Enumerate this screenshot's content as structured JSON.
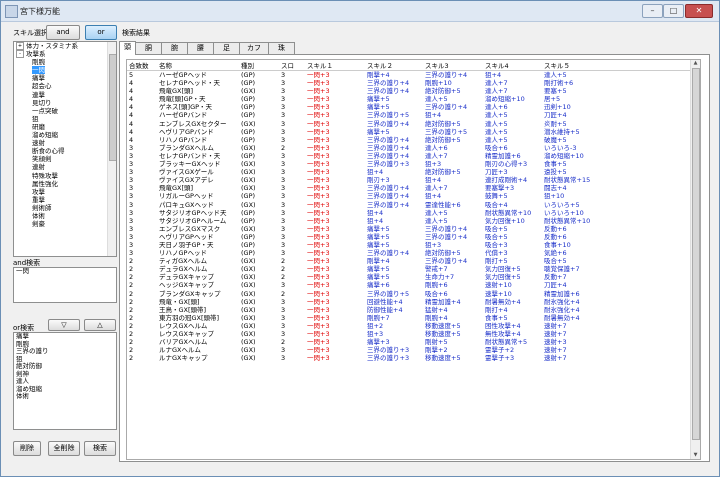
{
  "window": {
    "title": "宮下様万能",
    "min": "–",
    "max": "□",
    "close": "✕"
  },
  "left": {
    "skill_select_label": "スキル選択",
    "and_label": "and",
    "or_label": "or",
    "tree": [
      {
        "t": "体力・スタミナ系",
        "exp": "+",
        "lv": 0
      },
      {
        "t": "攻撃系",
        "exp": "-",
        "lv": 0
      },
      {
        "t": "剛腕",
        "lv": 1
      },
      {
        "t": "一閃",
        "lv": 1,
        "sel": true
      },
      {
        "t": "痛撃",
        "lv": 1
      },
      {
        "t": "超会心",
        "lv": 1
      },
      {
        "t": "連撃",
        "lv": 1
      },
      {
        "t": "見切り",
        "lv": 1
      },
      {
        "t": "一点突破",
        "lv": 1
      },
      {
        "t": "狙",
        "lv": 1
      },
      {
        "t": "研磨",
        "lv": 1
      },
      {
        "t": "溜め短縮",
        "lv": 1
      },
      {
        "t": "速射",
        "lv": 1
      },
      {
        "t": "断食の心得",
        "lv": 1
      },
      {
        "t": "笑顔剣",
        "lv": 1
      },
      {
        "t": "連射",
        "lv": 1
      },
      {
        "t": "特殊攻撃",
        "lv": 1
      },
      {
        "t": "属性強化",
        "lv": 1
      },
      {
        "t": "攻撃",
        "lv": 1
      },
      {
        "t": "重撃",
        "lv": 1
      },
      {
        "t": "剣術師",
        "lv": 1
      },
      {
        "t": "体術",
        "lv": 1
      },
      {
        "t": "剣豪",
        "lv": 1
      }
    ],
    "and_search_label": "and検索",
    "and_items": [
      "一閃"
    ],
    "down_btn": "▽",
    "up_btn": "△",
    "or_search_label": "or検索",
    "or_items": [
      "痛撃",
      "剛腕",
      "三界の護り",
      "狙",
      "絶対防御",
      "剣神",
      "達人",
      "溜め短縮",
      "体術"
    ],
    "delete_btn": "削除",
    "clear_all_btn": "全削除",
    "search_btn": "検索"
  },
  "results": {
    "label": "検索結果",
    "tabs": [
      "頭",
      "胴",
      "腕",
      "腰",
      "足",
      "カフ",
      "珠"
    ],
    "columns": [
      "合致数",
      "名称",
      "種別",
      "スロ",
      "スキル１",
      "スキル２",
      "スキル3",
      "スキル4",
      "スキル５"
    ],
    "rows": [
      [
        "5",
        "ハーゼGPヘッド",
        "(GP)",
        "3",
        "一閃+3",
        "剛撃+4",
        "三界の護り+4",
        "狙+4",
        "達人+5"
      ],
      [
        "4",
        "セレナGPヘッド・天",
        "(GP)",
        "3",
        "一閃+3",
        "三界の護り+4",
        "剛腕+10",
        "達人+7",
        "剛打術+6"
      ],
      [
        "4",
        "飛竜GX[頭]",
        "(GX)",
        "3",
        "一閃+3",
        "三界の護り+4",
        "絶対防御+5",
        "達人+7",
        "要塞+5"
      ],
      [
        "4",
        "飛竜[頭]GP・天",
        "(GP)",
        "3",
        "一閃+3",
        "痛撃+5",
        "達人+5",
        "溜め短縮+10",
        "居+5"
      ],
      [
        "4",
        "ゲネス[頭]GP・天",
        "(GP)",
        "3",
        "一閃+3",
        "痛撃+5",
        "三界の護り+4",
        "達人+6",
        "迅剣+10"
      ],
      [
        "4",
        "ハーゼGPバンド",
        "(GP)",
        "3",
        "一閃+3",
        "三界の護り+5",
        "狙+4",
        "達人+5",
        "刀匠+4"
      ],
      [
        "4",
        "エンブレスGXセクター",
        "(GX)",
        "3",
        "一閃+3",
        "三界の護り+4",
        "絶対防御+5",
        "達人+5",
        "炎耐+5"
      ],
      [
        "4",
        "ヘヴリアGPバンド",
        "(GP)",
        "3",
        "一閃+3",
        "痛撃+5",
        "三界の護り+5",
        "達人+5",
        "潜水維持+5"
      ],
      [
        "4",
        "リハノGPバンド",
        "(GP)",
        "3",
        "一閃+3",
        "三界の護り+4",
        "絶対防御+5",
        "達人+5",
        "破魔+5"
      ],
      [
        "3",
        "ブランダGXヘルム",
        "(GX)",
        "2",
        "一閃+3",
        "三界の護り+4",
        "達人+6",
        "吸合+6",
        "いろいろ-3"
      ],
      [
        "3",
        "セレナGPバンド・天",
        "(GP)",
        "3",
        "一閃+3",
        "三界の護り+4",
        "達人+7",
        "精霊加護+6",
        "溜め短縮+10"
      ],
      [
        "3",
        "ブラッキーGXヘッド",
        "(GX)",
        "3",
        "一閃+3",
        "三界の護り+3",
        "狙+3",
        "剛刃の心得+3",
        "食事+5"
      ],
      [
        "3",
        "ヴァイスGXゲール",
        "(GX)",
        "3",
        "一閃+3",
        "狙+4",
        "絶対防御+5",
        "刀匠+3",
        "遠投+5"
      ],
      [
        "3",
        "ヴァイスGXアデレ",
        "(GX)",
        "3",
        "一閃+3",
        "剛刃+3",
        "狙+4",
        "連打成剛術+4",
        "耐状態異常+15"
      ],
      [
        "3",
        "飛竜GX[頭]",
        "(GX)",
        "3",
        "一閃+3",
        "三界の護り+4",
        "達人+7",
        "要塞撃+3",
        "闘志+4"
      ],
      [
        "3",
        "リガルーGPヘッド",
        "(GP)",
        "3",
        "一閃+3",
        "三界の護り+4",
        "狙+4",
        "鼓舞+5",
        "狙+10"
      ],
      [
        "3",
        "パロキュGXヘッド",
        "(GX)",
        "3",
        "一閃+3",
        "三界の護り+4",
        "霊達性能+6",
        "吸合+4",
        "いろいろ+5"
      ],
      [
        "3",
        "サタジリオGPヘッド天",
        "(GP)",
        "3",
        "一閃+3",
        "狙+4",
        "達人+5",
        "耐状態異常+10",
        "いろいろ+10"
      ],
      [
        "3",
        "サタジリオGPヘルーム",
        "(GP)",
        "3",
        "一閃+3",
        "狙+4",
        "達人+5",
        "気力回復+10",
        "耐状態異常+10"
      ],
      [
        "3",
        "エンブレスGXマスク",
        "(GX)",
        "3",
        "一閃+3",
        "痛撃+5",
        "三界の護り+4",
        "吸合+5",
        "反動+6"
      ],
      [
        "3",
        "ヘヴリアGPヘッド",
        "(GP)",
        "3",
        "一閃+3",
        "痛撃+5",
        "三界の護り+4",
        "吸合+5",
        "反動+6"
      ],
      [
        "3",
        "天日ノ羽子GP・天",
        "(GP)",
        "3",
        "一閃+3",
        "痛撃+5",
        "狙+3",
        "吸合+3",
        "食事+10"
      ],
      [
        "3",
        "リハノGPヘッド",
        "(GP)",
        "3",
        "一閃+3",
        "三界の護り+4",
        "絶対防御+5",
        "代償+3",
        "気絶+6"
      ],
      [
        "2",
        "ティガGXヘルム",
        "(GX)",
        "2",
        "一閃+3",
        "剛撃+4",
        "三界の護り+4",
        "剛打+5",
        "吸合+5"
      ],
      [
        "2",
        "デュラGXヘルム",
        "(GX)",
        "2",
        "一閃+3",
        "痛撃+5",
        "警戒+7",
        "気力回復+5",
        "聴覚保護+7"
      ],
      [
        "2",
        "デュラGXキャップ",
        "(GX)",
        "2",
        "一閃+3",
        "痛撃+5",
        "生命力+7",
        "気力回復+5",
        "反動+7"
      ],
      [
        "2",
        "ヘッジGXキャップ",
        "(GX)",
        "3",
        "一閃+3",
        "痛撃+6",
        "剛腕+6",
        "速射+10",
        "刀匠+4"
      ],
      [
        "2",
        "ブランダGXキャップ",
        "(GX)",
        "2",
        "一閃+3",
        "三界の護り+5",
        "吸合+6",
        "速撃+10",
        "精霊加護+6"
      ],
      [
        "2",
        "飛竜・GX[頭]",
        "(GX)",
        "3",
        "一閃+3",
        "回避性能+4",
        "精霊加護+4",
        "耐暑無効+4",
        "耐氷強化+4"
      ],
      [
        "2",
        "王鳥・GX[頭帯]",
        "(GX)",
        "3",
        "一閃+3",
        "防御性能+4",
        "猛射+4",
        "剛打+4",
        "耐氷強化+4"
      ],
      [
        "2",
        "東方羽の冠GX[頭帯]",
        "(GX)",
        "3",
        "一閃+3",
        "剛腕+7",
        "剛腕+4",
        "食事+5",
        "耐暑無効+4"
      ],
      [
        "2",
        "レウスGXヘルム",
        "(GX)",
        "3",
        "一閃+3",
        "狙+2",
        "移動速度+5",
        "困性攻撃+4",
        "速射+7"
      ],
      [
        "2",
        "レウスGXキャップ",
        "(GX)",
        "3",
        "一閃+3",
        "狙+3",
        "移動速度+5",
        "無性攻撃+4",
        "速射+7"
      ],
      [
        "2",
        "バリアGXヘルム",
        "(GX)",
        "2",
        "一閃+3",
        "痛撃+3",
        "剛射+5",
        "耐状態異常+5",
        "速射+3"
      ],
      [
        "2",
        "ルナGXヘルム",
        "(GX)",
        "3",
        "一閃+3",
        "三界の護り+3",
        "剛撃+2",
        "霊撃子+2",
        "速射+7"
      ],
      [
        "2",
        "ルナGXキャップ",
        "(GX)",
        "3",
        "一閃+3",
        "三界の護り+3",
        "移動速度+5",
        "霊撃子+3",
        "速射+7"
      ]
    ]
  }
}
